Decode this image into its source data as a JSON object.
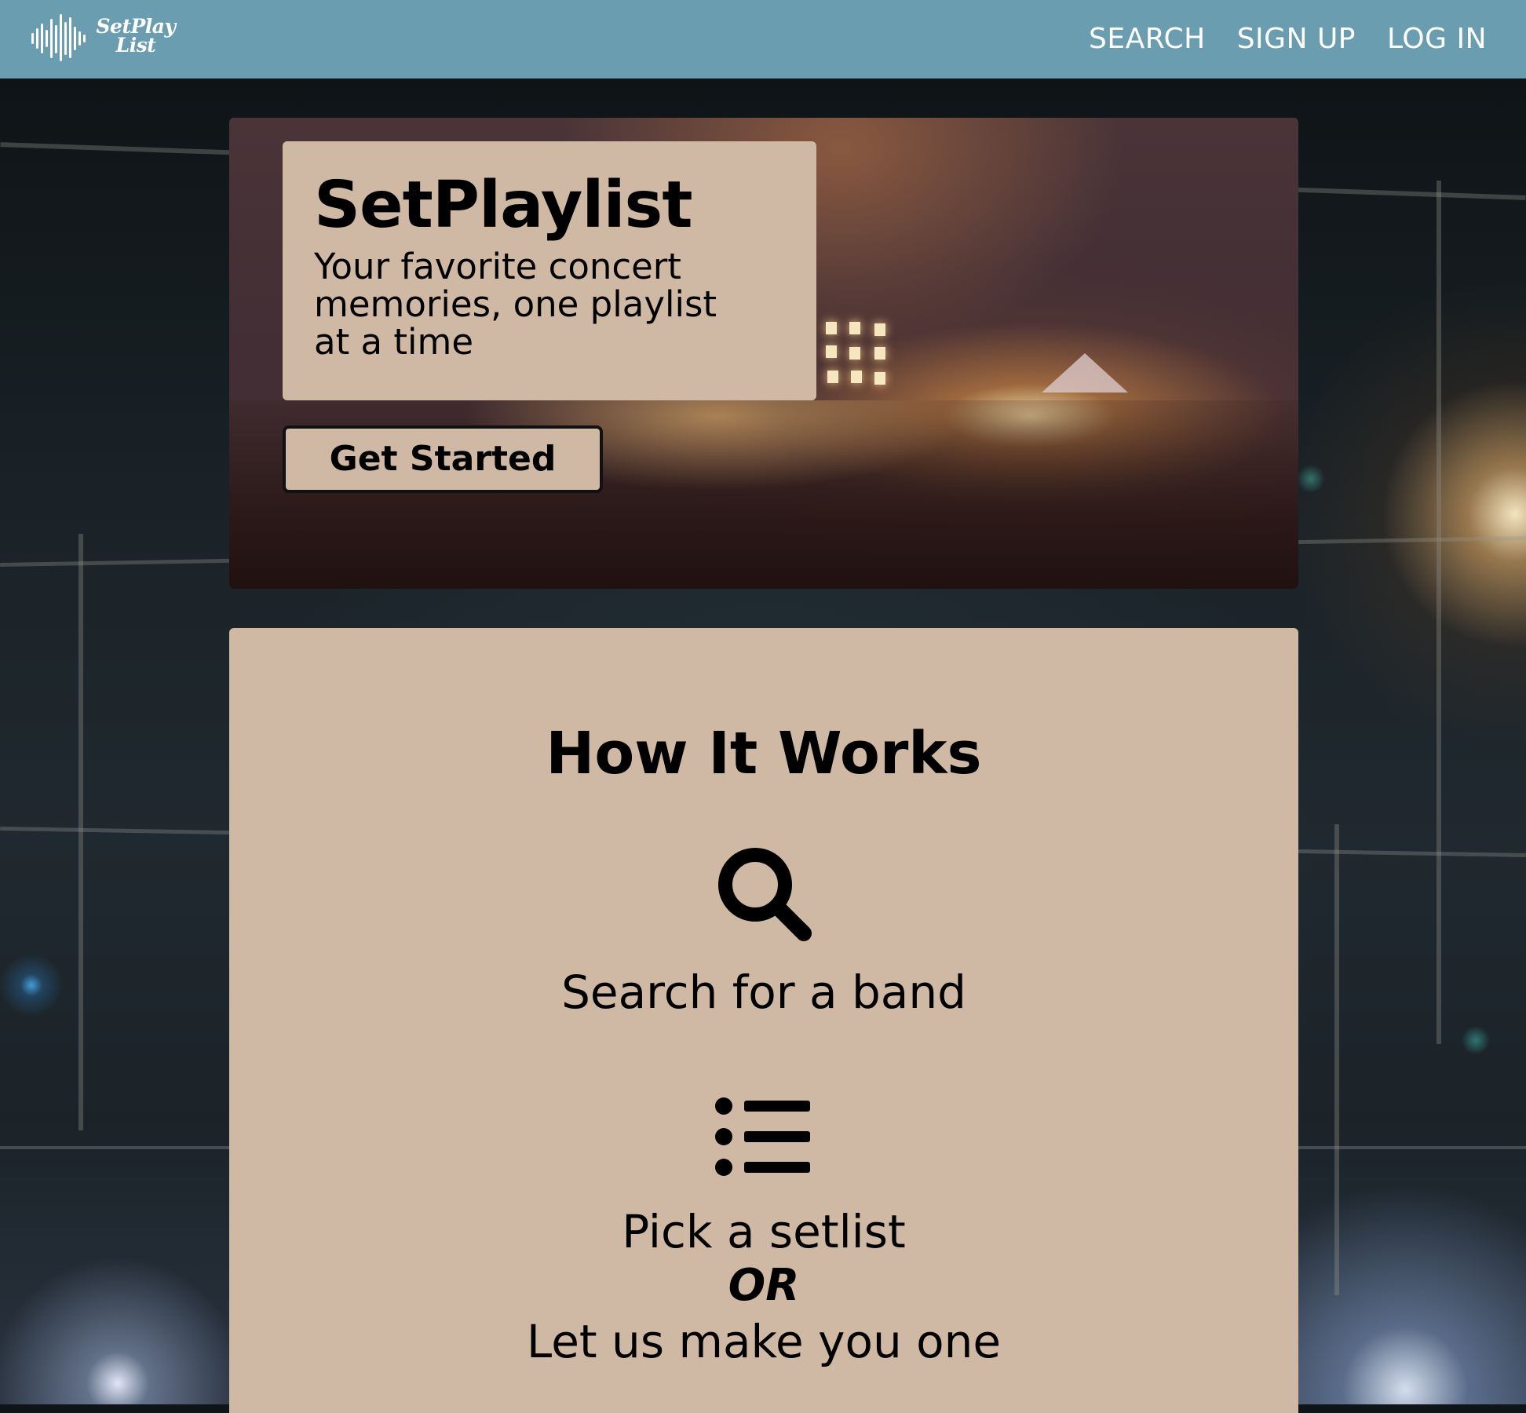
{
  "header": {
    "logo_text": "SetPlay\nList",
    "nav": [
      "SEARCH",
      "SIGN UP",
      "LOG IN"
    ],
    "background_color": "#6a9daf"
  },
  "hero": {
    "title": "SetPlaylist",
    "subtitle": "Your favorite concert memories, one playlist at a time",
    "cta_label": "Get Started",
    "card_color": "#cfb9a5"
  },
  "how_it_works": {
    "title": "How It Works",
    "steps": [
      {
        "icon": "search-icon",
        "text": "Search for a band"
      },
      {
        "icon": "list-icon",
        "text": "Pick a setlist",
        "or": "OR",
        "alt_text": "Let us make you one"
      }
    ]
  }
}
